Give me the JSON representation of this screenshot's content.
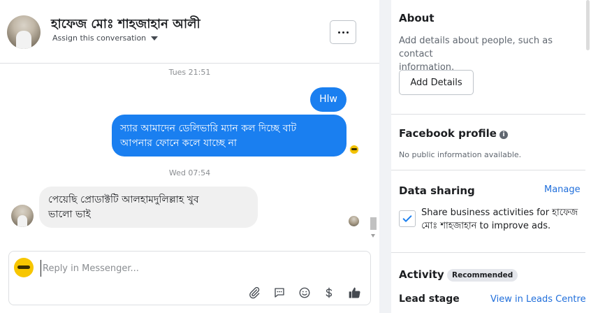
{
  "header": {
    "contact_name": "হাফেজ মোঃ শাহজাহান আলী",
    "assign_label": "Assign this conversation"
  },
  "messages": {
    "timestamp_1": "Tues 21:51",
    "out_1": "Hlw",
    "out_2_line1": "স্যার আমাদেন ডেলিভারি ম্যান কল দিচ্ছে বাট",
    "out_2_line2": "আপনার ফোনে কলে যাচ্ছে না",
    "timestamp_2": "Wed 07:54",
    "in_1_line1": "পেয়েছি প্রোডাক্টটি আলহামদুলিল্লাহ খুব",
    "in_1_line2": "ভালো ভাই"
  },
  "composer": {
    "placeholder": "Reply in Messenger...",
    "tools": [
      "paperclip-icon",
      "saved-reply-icon",
      "emoji-icon",
      "dollar-icon",
      "thumbs-up-icon"
    ]
  },
  "about": {
    "title": "About",
    "description_line1": "Add details about people, such as contact",
    "description_line2": "information.",
    "button": "Add Details"
  },
  "facebook_profile": {
    "title": "Facebook profile",
    "info_glyph": "i",
    "note": "No public information available."
  },
  "data_sharing": {
    "title": "Data sharing",
    "manage": "Manage",
    "checkbox_line1": "Share business activities for হাফেজ",
    "checkbox_line2": "মোঃ শাহজাহান to improve ads.",
    "checked": true
  },
  "activity": {
    "title": "Activity",
    "badge": "Recommended",
    "lead_stage_label": "Lead stage",
    "lead_stage_link": "View in Leads Centre"
  },
  "colors": {
    "outgoing_bubble": "#1a7ff0",
    "incoming_bubble": "#f0f0f0",
    "link": "#216fdb",
    "page_logo": "#f7c600"
  }
}
